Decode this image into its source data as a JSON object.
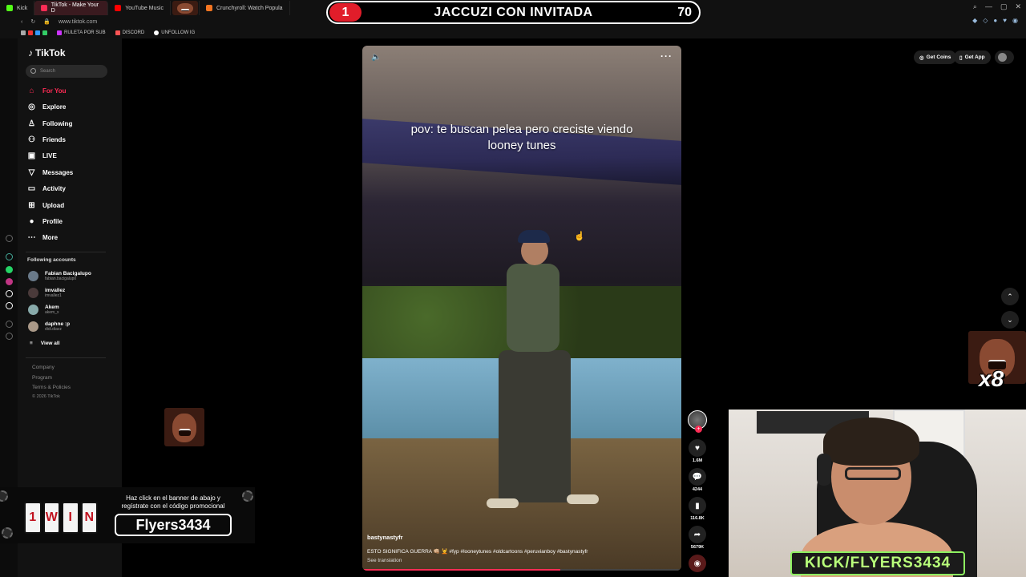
{
  "browser": {
    "tabs": [
      {
        "label": "Kick",
        "color": "#53fc18",
        "active": false
      },
      {
        "label": "TikTok - Make Your D",
        "color": "#fe2c55",
        "active": true
      },
      {
        "label": "YouTube Music",
        "color": "#ff0000",
        "active": false
      },
      {
        "label": "Crunchyroll: Watch Popula",
        "color": "#f47521",
        "active": false
      }
    ],
    "url": "www.tiktok.com",
    "bookmarks": [
      "RULETA POR SUB",
      "DISCORD",
      "UNFOLLOW IG"
    ]
  },
  "stream_banner": {
    "number": "1",
    "title": "JACCUZI CON INVITADA",
    "count": "70"
  },
  "sidebar": {
    "logo": "TikTok",
    "search_placeholder": "Search",
    "nav": [
      {
        "label": "For You",
        "icon": "home-icon",
        "active": true
      },
      {
        "label": "Explore",
        "icon": "compass-icon",
        "active": false
      },
      {
        "label": "Following",
        "icon": "following-icon",
        "active": false
      },
      {
        "label": "Friends",
        "icon": "friends-icon",
        "active": false
      },
      {
        "label": "LIVE",
        "icon": "live-icon",
        "active": false
      },
      {
        "label": "Messages",
        "icon": "messages-icon",
        "active": false
      },
      {
        "label": "Activity",
        "icon": "activity-icon",
        "active": false
      },
      {
        "label": "Upload",
        "icon": "upload-icon",
        "active": false
      },
      {
        "label": "Profile",
        "icon": "profile-icon",
        "active": false
      },
      {
        "label": "More",
        "icon": "more-icon",
        "active": false
      }
    ],
    "following_title": "Following accounts",
    "accounts": [
      {
        "name": "Fabian Bacigalupo",
        "handle": "fabian.bacigalupo"
      },
      {
        "name": "imvallez",
        "handle": "imvallez1"
      },
      {
        "name": "Akem",
        "handle": "akem_x"
      },
      {
        "name": "daphne :p",
        "handle": "didi.diavz"
      }
    ],
    "view_all": "View all",
    "footer": [
      "Company",
      "Program",
      "Terms & Policies",
      "© 2026 TikTok"
    ]
  },
  "video": {
    "caption": "pov: te buscan pelea pero creciste viendo looney tunes",
    "author": "bastynastyfr",
    "description": "ESTO SIGNIFICA GUERRA 👊🏼 💆 #fyp #looneytunes #oldcartoons #peruvianboy #bastynastyfr",
    "see_translation": "See translation",
    "progress": 0.62
  },
  "actions": {
    "likes": "1.6M",
    "comments": "4244",
    "saves": "116.8K",
    "shares": "5679K"
  },
  "header_buttons": {
    "get_coins": "Get Coins",
    "get_app": "Get App"
  },
  "promo": {
    "brand": "1WIN",
    "text": "Haz click en el banner de abajo y regístrate con el código promocional",
    "code": "Flyers3434"
  },
  "overlay": {
    "multiplier": "x8",
    "cam_label": "KICK/FLYERS3434"
  }
}
